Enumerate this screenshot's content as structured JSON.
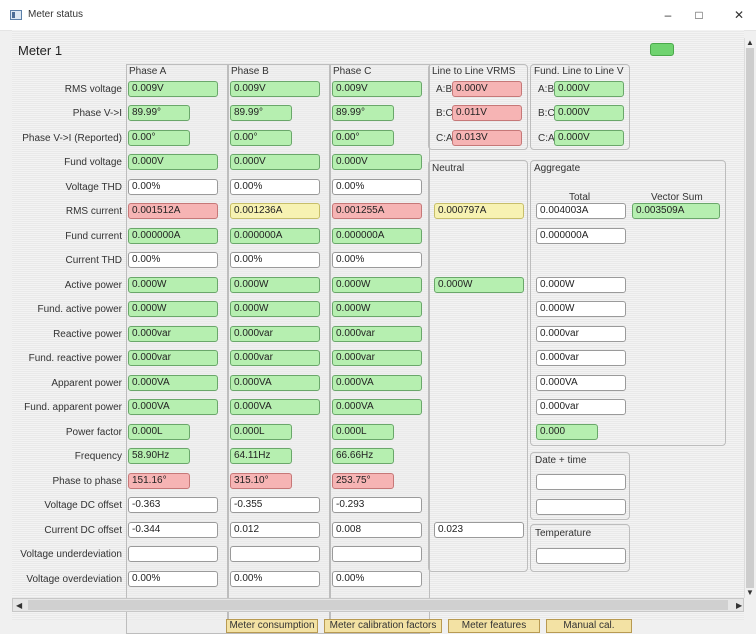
{
  "window": {
    "title": "Meter status",
    "minimize_glyph": "–",
    "maximize_glyph": "□",
    "close_glyph": "✕",
    "icon": "window-app-icon"
  },
  "meter": {
    "title": "Meter 1",
    "status_led_color": "#6fd36f"
  },
  "columns": {
    "phase_a": "Phase A",
    "phase_b": "Phase B",
    "phase_c": "Phase C",
    "line_to_line_vrms": "Line to Line VRMS",
    "fund_line_to_line_v": "Fund. Line to Line V",
    "neutral": "Neutral",
    "aggregate": "Aggregate",
    "total": "Total",
    "vector_sum": "Vector Sum"
  },
  "rows": [
    {
      "label": "RMS voltage",
      "a": "0.009V",
      "b": "0.009V",
      "c": "0.009V"
    },
    {
      "label": "Phase V->I",
      "a": "89.99°",
      "b": "89.99°",
      "c": "89.99°"
    },
    {
      "label": "Phase V->I (Reported)",
      "a": "0.00°",
      "b": "0.00°",
      "c": "0.00°"
    },
    {
      "label": "Fund voltage",
      "a": "0.000V",
      "b": "0.000V",
      "c": "0.000V"
    },
    {
      "label": "Voltage THD",
      "a": "0.00%",
      "b": "0.00%",
      "c": "0.00%"
    },
    {
      "label": "RMS current",
      "a": "0.001512A",
      "b": "0.001236A",
      "c": "0.001255A"
    },
    {
      "label": "Fund current",
      "a": "0.000000A",
      "b": "0.000000A",
      "c": "0.000000A"
    },
    {
      "label": "Current THD",
      "a": "0.00%",
      "b": "0.00%",
      "c": "0.00%"
    },
    {
      "label": "Active power",
      "a": "0.000W",
      "b": "0.000W",
      "c": "0.000W"
    },
    {
      "label": "Fund. active power",
      "a": "0.000W",
      "b": "0.000W",
      "c": "0.000W"
    },
    {
      "label": "Reactive power",
      "a": "0.000var",
      "b": "0.000var",
      "c": "0.000var"
    },
    {
      "label": "Fund. reactive power",
      "a": "0.000var",
      "b": "0.000var",
      "c": "0.000var"
    },
    {
      "label": "Apparent power",
      "a": "0.000VA",
      "b": "0.000VA",
      "c": "0.000VA"
    },
    {
      "label": "Fund. apparent power",
      "a": "0.000VA",
      "b": "0.000VA",
      "c": "0.000VA"
    },
    {
      "label": "Power factor",
      "a": "0.000L",
      "b": "0.000L",
      "c": "0.000L"
    },
    {
      "label": "Frequency",
      "a": "58.90Hz",
      "b": "64.11Hz",
      "c": "66.66Hz"
    },
    {
      "label": "Phase to phase",
      "a": "151.16°",
      "b": "315.10°",
      "c": "253.75°"
    },
    {
      "label": "Voltage DC offset",
      "a": "-0.363",
      "b": "-0.355",
      "c": "-0.293"
    },
    {
      "label": "Current DC offset",
      "a": "-0.344",
      "b": "0.012",
      "c": "0.008"
    },
    {
      "label": "Voltage underdeviation",
      "a": "",
      "b": "",
      "c": ""
    },
    {
      "label": "Voltage overdeviation",
      "a": "0.00%",
      "b": "0.00%",
      "c": "0.00%"
    }
  ],
  "line_to_line": [
    {
      "label": "A:B",
      "vrms": "0.000V",
      "fund": "0.000V"
    },
    {
      "label": "B:C",
      "vrms": "0.011V",
      "fund": "0.000V"
    },
    {
      "label": "C:A",
      "vrms": "0.013V",
      "fund": "0.000V"
    }
  ],
  "neutral": {
    "rms_current": "0.000797A",
    "active_power": "0.000W",
    "current_dc_offset": "0.023"
  },
  "aggregate": {
    "rms_current_total": "0.004003A",
    "rms_current_vector_sum": "0.003509A",
    "fund_current": "0.000000A",
    "active_power": "0.000W",
    "fund_active_power": "0.000W",
    "reactive_power": "0.000var",
    "fund_reactive_power": "0.000var",
    "apparent_power": "0.000VA",
    "fund_apparent_power": "0.000var",
    "power_factor": "0.000"
  },
  "date_time": {
    "label": "Date + time",
    "value1": "",
    "value2": "",
    "value3": ""
  },
  "temperature": {
    "label": "Temperature",
    "value": ""
  },
  "scroll": {
    "left_arrow": "◀",
    "right_arrow": "▶",
    "up_arrow": "▲",
    "down_arrow": "▼"
  },
  "bottom_buttons": {
    "meter_consumption": "Meter consumption",
    "meter_calibration_factors": "Meter calibration factors",
    "meter_features": "Meter features",
    "manual_cal": "Manual cal."
  },
  "colors": {
    "green": "#b6efb0",
    "red": "#f6b4b4",
    "yellow": "#f7f2b2"
  }
}
